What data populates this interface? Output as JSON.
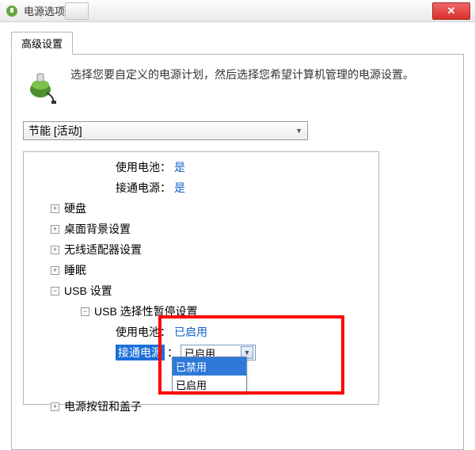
{
  "window": {
    "title": "电源选项"
  },
  "tab": {
    "label": "高级设置"
  },
  "intro": {
    "text": "选择您要自定义的电源计划，然后选择您希望计算机管理的电源设置。"
  },
  "plan_select": {
    "value": "节能 [活动]"
  },
  "tree": {
    "top_battery": {
      "label": "使用电池：",
      "value": "是"
    },
    "top_ac": {
      "label": "接通电源：",
      "value": "是"
    },
    "items": [
      {
        "label": "硬盘"
      },
      {
        "label": "桌面背景设置"
      },
      {
        "label": "无线适配器设置"
      },
      {
        "label": "睡眠"
      }
    ],
    "usb": {
      "label": "USB 设置",
      "suspend": {
        "label": "USB 选择性暂停设置",
        "battery": {
          "label": "使用电池：",
          "value": "已启用"
        },
        "ac_label": "接通电源",
        "ac_colon": "：",
        "ac_value": "已启用",
        "options": [
          {
            "label": "已禁用"
          },
          {
            "label": "已启用"
          }
        ]
      }
    },
    "power_button": {
      "label": "电源按钮和盖子"
    }
  },
  "glyphs": {
    "plus": "+",
    "minus": "−",
    "chev_down": "▼",
    "close_x": "✕"
  }
}
